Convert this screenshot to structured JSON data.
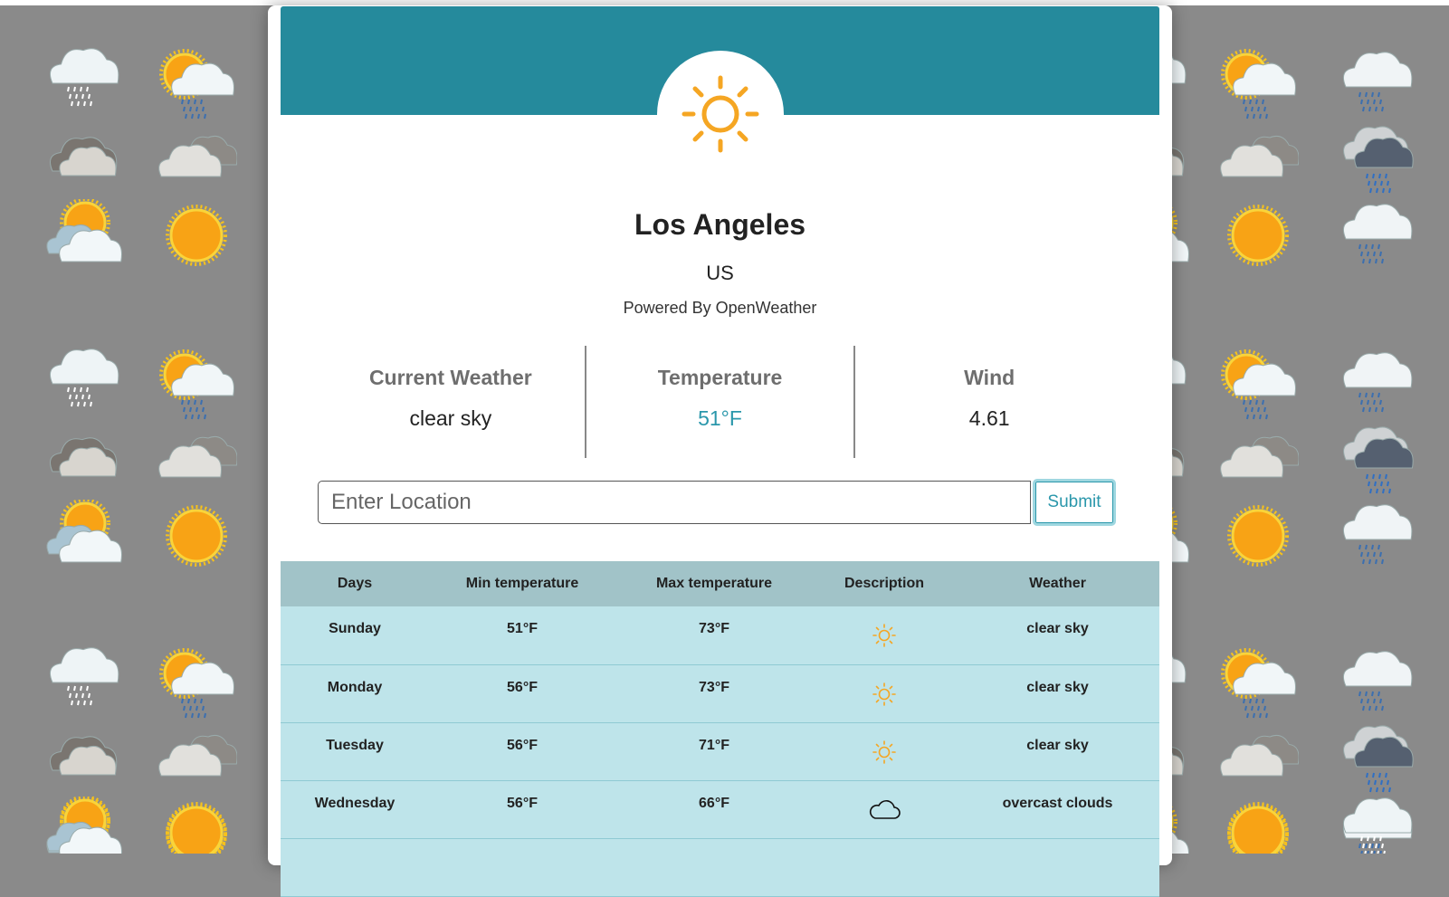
{
  "location": {
    "city": "Los Angeles",
    "country": "US",
    "powered_by": "Powered By OpenWeather"
  },
  "current": {
    "weather_label": "Current Weather",
    "weather_value": "clear sky",
    "temperature_label": "Temperature",
    "temperature_value": "51°F",
    "wind_label": "Wind",
    "wind_value": "4.61",
    "icon": "sun-icon"
  },
  "search": {
    "placeholder": "Enter Location",
    "value": "",
    "submit_label": "Submit"
  },
  "forecast": {
    "headers": [
      "Days",
      "Min temperature",
      "Max temperature",
      "Description",
      "Weather"
    ],
    "rows": [
      {
        "day": "Sunday",
        "min": "51°F",
        "max": "73°F",
        "icon": "sun-icon",
        "weather": "clear sky"
      },
      {
        "day": "Monday",
        "min": "56°F",
        "max": "73°F",
        "icon": "sun-icon",
        "weather": "clear sky"
      },
      {
        "day": "Tuesday",
        "min": "56°F",
        "max": "71°F",
        "icon": "sun-icon",
        "weather": "clear sky"
      },
      {
        "day": "Wednesday",
        "min": "56°F",
        "max": "66°F",
        "icon": "cloud-icon",
        "weather": "overcast clouds"
      }
    ]
  },
  "colors": {
    "banner": "#258a9c",
    "accent": "#2a97ab",
    "sun": "#f5a623",
    "table_header": "#a1c3c8",
    "table_row": "#bee4ea",
    "background": "#8a8a8a"
  },
  "background_icons": [
    "snow-cloud-icon",
    "sun-rain-cloud-icon",
    "dark-clouds-icon",
    "partly-cloudy-icon",
    "sun-icon",
    "rain-cloud-icon",
    "storm-rain-cloud-icon"
  ]
}
